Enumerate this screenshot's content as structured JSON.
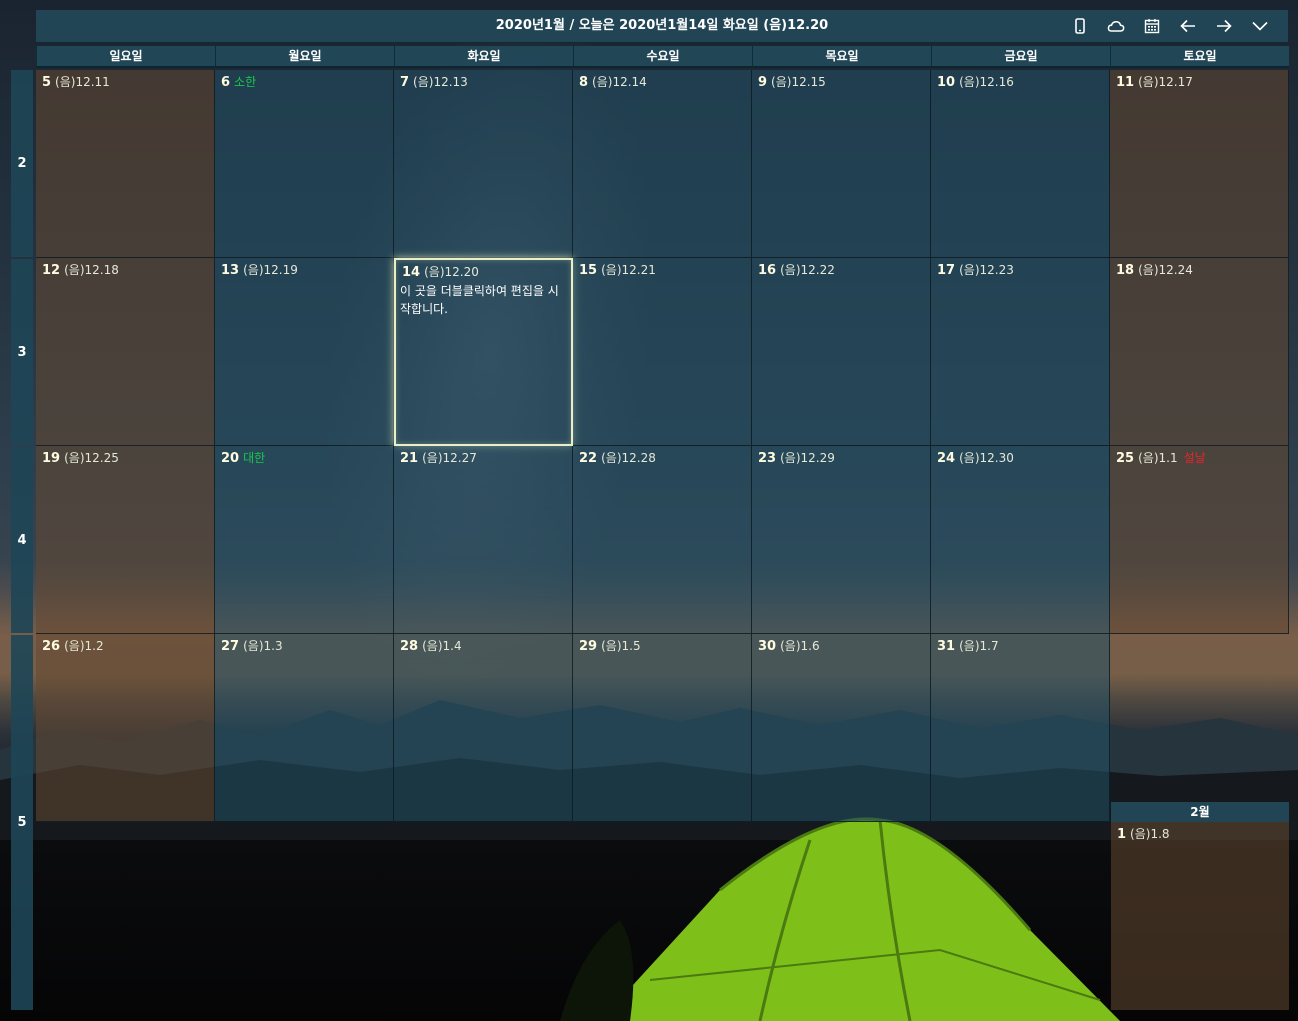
{
  "header": {
    "title": "2020년1월 / 오늘은 2020년1월14일 화요일 (음)12.20",
    "icons": [
      "phone-icon",
      "cloud-icon",
      "calendar-icon",
      "arrow-left-icon",
      "arrow-right-icon",
      "chevron-down-icon"
    ]
  },
  "weekdays": [
    "일요일",
    "월요일",
    "화요일",
    "수요일",
    "목요일",
    "금요일",
    "토요일"
  ],
  "weeks": [
    "2",
    "3",
    "4",
    "5"
  ],
  "days": [
    {
      "num": "5",
      "lunar": "(음)12.11",
      "type": "we"
    },
    {
      "num": "6",
      "holiday": "소한",
      "holiday_color": "green",
      "type": "wd"
    },
    {
      "num": "7",
      "lunar": "(음)12.13",
      "type": "wd"
    },
    {
      "num": "8",
      "lunar": "(음)12.14",
      "type": "wd"
    },
    {
      "num": "9",
      "lunar": "(음)12.15",
      "type": "wd"
    },
    {
      "num": "10",
      "lunar": "(음)12.16",
      "type": "wd"
    },
    {
      "num": "11",
      "lunar": "(음)12.17",
      "type": "we"
    },
    {
      "num": "12",
      "lunar": "(음)12.18",
      "type": "we"
    },
    {
      "num": "13",
      "lunar": "(음)12.19",
      "type": "wd"
    },
    {
      "num": "14",
      "lunar": "(음)12.20",
      "type": "wd",
      "today": true,
      "note": "이 곳을 더블클릭하여 편집을 시작합니다."
    },
    {
      "num": "15",
      "lunar": "(음)12.21",
      "type": "wd"
    },
    {
      "num": "16",
      "lunar": "(음)12.22",
      "type": "wd"
    },
    {
      "num": "17",
      "lunar": "(음)12.23",
      "type": "wd"
    },
    {
      "num": "18",
      "lunar": "(음)12.24",
      "type": "we"
    },
    {
      "num": "19",
      "lunar": "(음)12.25",
      "type": "we"
    },
    {
      "num": "20",
      "holiday": "대한",
      "holiday_color": "green",
      "type": "wd"
    },
    {
      "num": "21",
      "lunar": "(음)12.27",
      "type": "wd"
    },
    {
      "num": "22",
      "lunar": "(음)12.28",
      "type": "wd"
    },
    {
      "num": "23",
      "lunar": "(음)12.29",
      "type": "wd"
    },
    {
      "num": "24",
      "lunar": "(음)12.30",
      "type": "wd"
    },
    {
      "num": "25",
      "lunar": "(음)1.1",
      "holiday": "설날",
      "holiday_color": "red",
      "type": "we"
    },
    {
      "num": "26",
      "lunar": "(음)1.2",
      "type": "we"
    },
    {
      "num": "27",
      "lunar": "(음)1.3",
      "type": "wd"
    },
    {
      "num": "28",
      "lunar": "(음)1.4",
      "type": "wd"
    },
    {
      "num": "29",
      "lunar": "(음)1.5",
      "type": "wd"
    },
    {
      "num": "30",
      "lunar": "(음)1.6",
      "type": "wd"
    },
    {
      "num": "31",
      "lunar": "(음)1.7",
      "type": "wd"
    }
  ],
  "next_month": {
    "label": "2월",
    "day": {
      "num": "1",
      "lunar": "(음)1.8"
    }
  },
  "colors": {
    "weekday_cell": "#225064",
    "weekend_cell": "#644832",
    "header_bar": "#224858",
    "holiday_green": "#19c94a",
    "holiday_red": "#e8242a",
    "today_border": "#e9efc8"
  }
}
